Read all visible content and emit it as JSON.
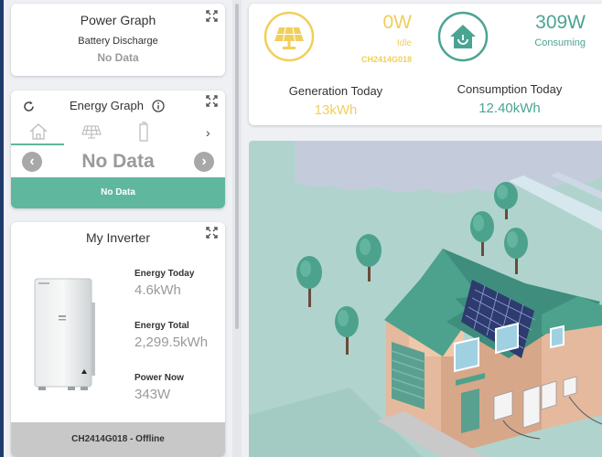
{
  "power_graph": {
    "title": "Power Graph",
    "subtitle": "Battery Discharge",
    "status": "No Data"
  },
  "energy_graph": {
    "title": "Energy Graph",
    "tabs": [
      "house-icon",
      "solar-panel-icon",
      "battery-icon"
    ],
    "status": "No Data",
    "footer": "No Data"
  },
  "inverter": {
    "title": "My Inverter",
    "energy_today_label": "Energy Today",
    "energy_today_value": "4.6kWh",
    "energy_total_label": "Energy Total",
    "energy_total_value": "2,299.5kWh",
    "power_now_label": "Power Now",
    "power_now_value": "343W",
    "footer": "CH2414G018 - Offline"
  },
  "generation": {
    "power": "0W",
    "state": "Idle",
    "device_id": "CH2414G018",
    "today_label": "Generation Today",
    "today_value": "13kWh"
  },
  "consumption": {
    "power": "309W",
    "state": "Consuming",
    "today_label": "Consumption Today",
    "today_value": "12.40kWh"
  },
  "colors": {
    "solar_yellow": "#f1cf5b",
    "consume_teal": "#4ba493",
    "footer_green": "#5fb79d",
    "page_bg": "#eef0f3"
  }
}
